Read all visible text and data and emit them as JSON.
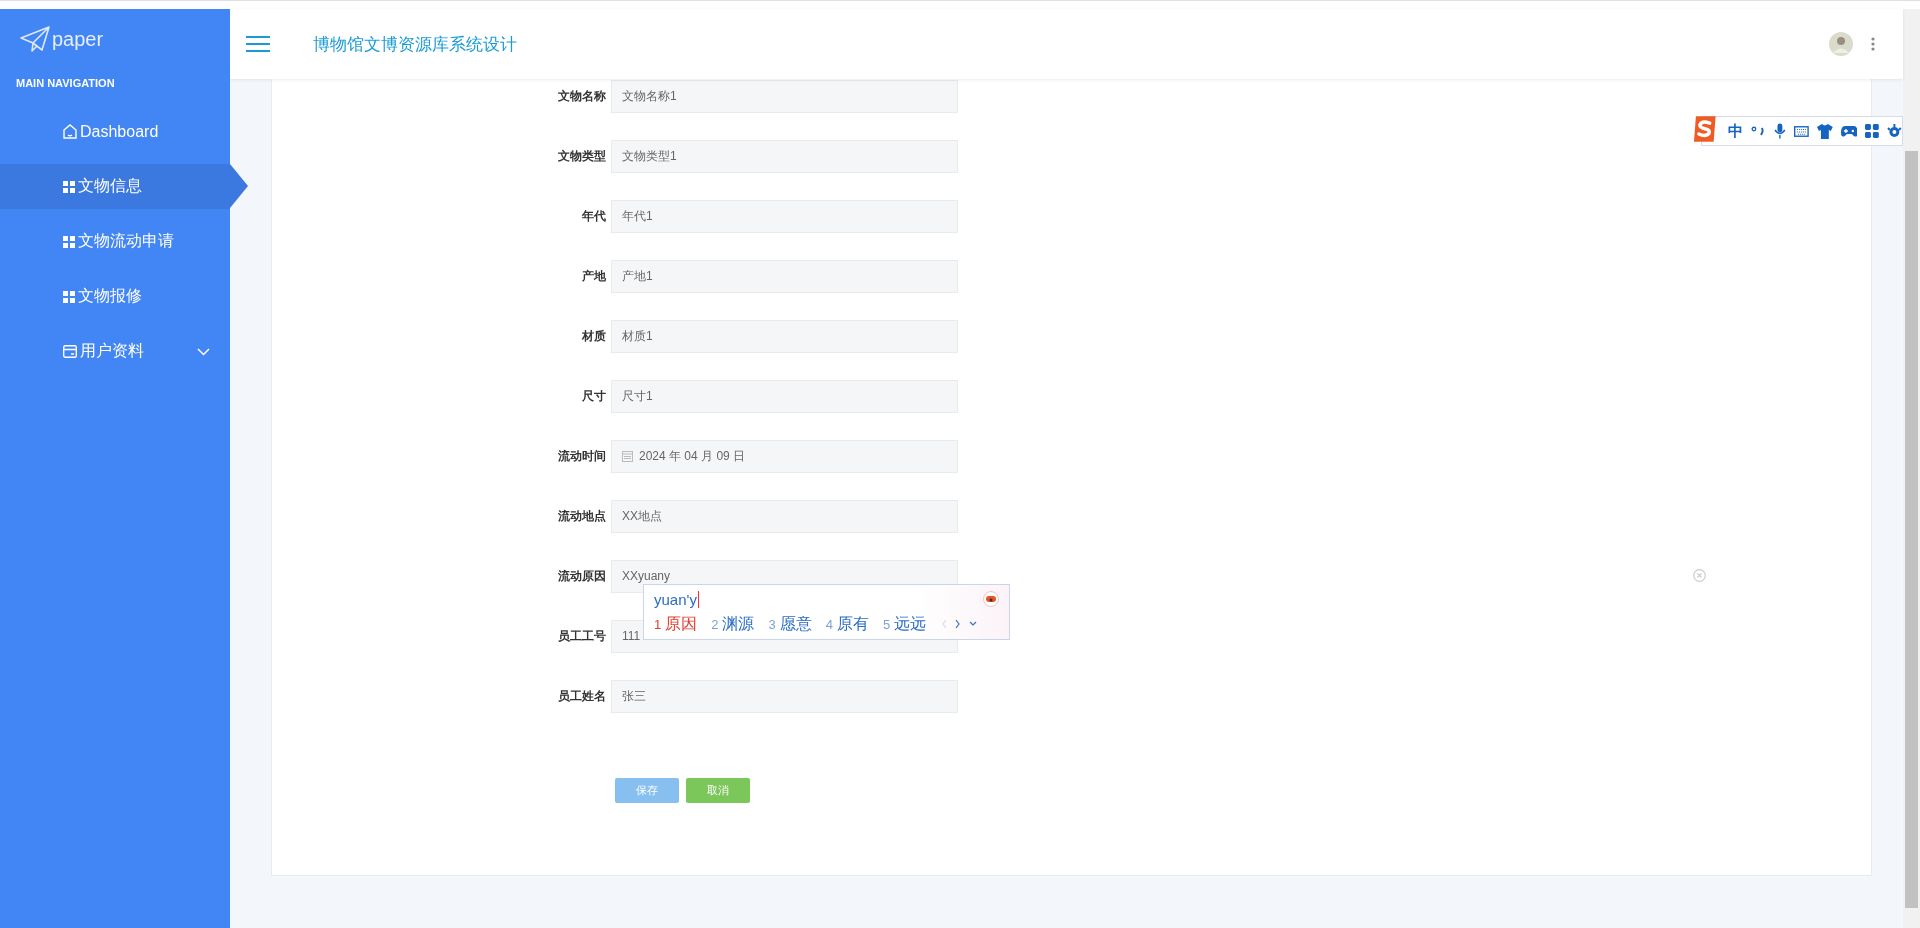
{
  "brand": "paper",
  "sidebar": {
    "heading": "MAIN NAVIGATION",
    "items": [
      {
        "label": "Dashboard",
        "kind": "dashboard",
        "selected": false
      },
      {
        "label": "文物信息",
        "kind": "module",
        "selected": true
      },
      {
        "label": "文物流动申请",
        "kind": "module",
        "selected": false
      },
      {
        "label": "文物报修",
        "kind": "module",
        "selected": false
      },
      {
        "label": "用户资料",
        "kind": "menu",
        "selected": false,
        "expanded": false
      }
    ]
  },
  "header": {
    "title": "博物馆文博资源库系统设计"
  },
  "form": {
    "fields": [
      {
        "label": "文物名称",
        "value": "文物名称1",
        "kind": "text"
      },
      {
        "label": "文物类型",
        "value": "文物类型1",
        "kind": "text"
      },
      {
        "label": "年代",
        "value": "年代1",
        "kind": "text"
      },
      {
        "label": "产地",
        "value": "产地1",
        "kind": "text"
      },
      {
        "label": "材质",
        "value": "材质1",
        "kind": "text"
      },
      {
        "label": "尺寸",
        "value": "尺寸1",
        "kind": "text"
      },
      {
        "label": "流动时间",
        "value": "2024 年 04 月 09 日",
        "kind": "date"
      },
      {
        "label": "流动地点",
        "value": "XX地点",
        "kind": "text"
      },
      {
        "label": "流动原因",
        "value": "XXyuany",
        "kind": "text"
      },
      {
        "label": "员工工号",
        "value": "111",
        "kind": "text"
      },
      {
        "label": "员工姓名",
        "value": "张三",
        "kind": "text"
      }
    ],
    "buttons": [
      {
        "label": "保存",
        "kind": "primary"
      },
      {
        "label": "取消",
        "kind": "success"
      }
    ]
  },
  "ime": {
    "composition": "yuan'y",
    "candidates": [
      {
        "number": "1",
        "text": "原因",
        "selected": true
      },
      {
        "number": "2",
        "text": "渊源",
        "selected": false
      },
      {
        "number": "3",
        "text": "愿意",
        "selected": false
      },
      {
        "number": "4",
        "text": "原有",
        "selected": false
      },
      {
        "number": "5",
        "text": "远远",
        "selected": false
      }
    ],
    "mode": "中"
  }
}
